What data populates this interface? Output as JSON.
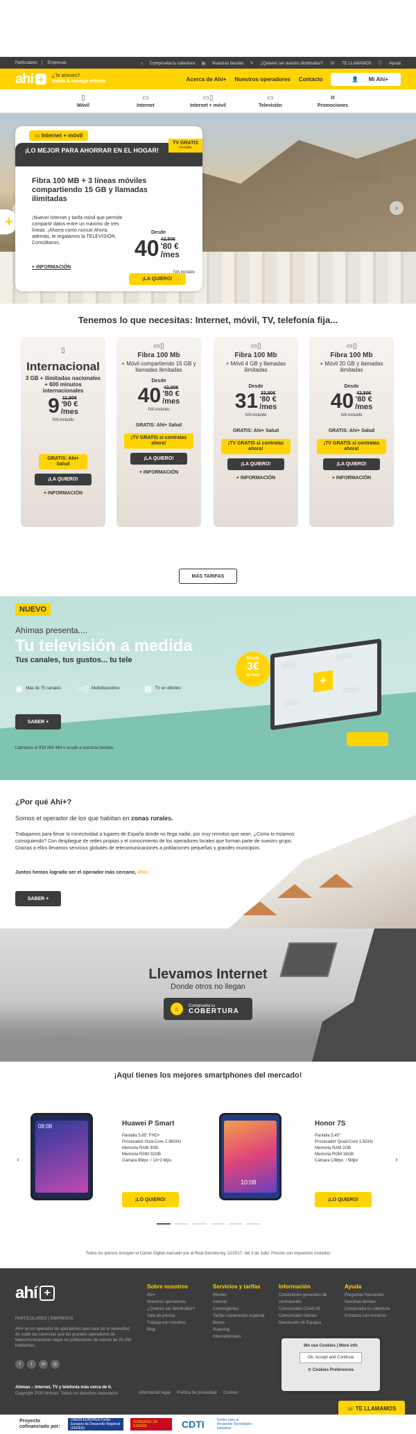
{
  "topbar": {
    "left": [
      "Particulares",
      "Empresas"
    ],
    "right": [
      "Comprueba tu cobertura",
      "Nuestras tiendas",
      "¿Quieres ser nuestro distribuidor?",
      "TE LLAMAMOS",
      "Ayuda"
    ]
  },
  "header": {
    "logo": "ahí",
    "tagline_q": "¿Te atreves?",
    "tagline": "Habla & navega infinito",
    "nav": [
      "Acerca de Ahí+",
      "Nuestros operadores",
      "Contacto"
    ],
    "my_account": "Mi Ahí+"
  },
  "subnav": [
    {
      "label": "Móvil",
      "icon": "mobile-icon"
    },
    {
      "label": "Internet",
      "icon": "desktop-icon"
    },
    {
      "label": "Internet + móvil",
      "icon": "devices-icon"
    },
    {
      "label": "Televisión",
      "icon": "tv-icon"
    },
    {
      "label": "Promociones",
      "icon": "tag-icon"
    }
  ],
  "hero": {
    "tag": "Internet + móvil",
    "tv_badge": "TV GRATIS",
    "tv_badge_sub": "Incluida",
    "dark_title": "¡LO MEJOR PARA AHORRAR EN EL HOGAR!",
    "title": "Fibra 100 MB + 3 líneas móviles compartiendo 15 GB y llamadas ilimitadas",
    "desc": "¡Nuevo! Internet y tarifa móvil que permite compartir datos entre un máximo de tres líneas. ¡Ahorra como nunca! Ahora, además, te regalamos la TELEVISIÓN. Consúltanos.",
    "more": "+ INFORMACIÓN",
    "from": "Desde",
    "old_price": "42,80€",
    "price_int": "40",
    "price_dec": "'80 €",
    "per": "/mes",
    "iva": "IVA incluido",
    "cta": "¡LA QUIERO!"
  },
  "section_title": "Tenemos lo que necesitas: Internet, móvil, TV, telefonía fija...",
  "cards": [
    {
      "title": "Internacional",
      "sub": "3 GB + ilimitadas nacionales + 600 minutos internacionales",
      "from": "",
      "old": "11,90€",
      "int": "9",
      "dec": "'90 €",
      "per": "/mes",
      "iva": "IVA incluido",
      "gift": "",
      "promo": "GRATIS: Ahí+ Salud",
      "cta": "¡LA QUIERO!",
      "info": "+ INFORMACIÓN"
    },
    {
      "title": "Fibra 100 Mb",
      "sub": "+ Móvil compartiendo 15 GB y llamadas ilimitadas",
      "from": "Desde",
      "old": "42,80€",
      "int": "40",
      "dec": "'80 €",
      "per": "/mes",
      "iva": "IVA incluido",
      "gift": "GRATIS: Ahí+ Salud",
      "promo": "¡TV GRATIS si contratas ahora!",
      "cta": "¡LA QUIERO!",
      "info": "+ INFORMACIÓN"
    },
    {
      "title": "Fibra 100 Mb",
      "sub": "+ Móvil 4 GB y llamadas ilimitadas",
      "from": "Desde",
      "old": "33,80€",
      "int": "31",
      "dec": "'80 €",
      "per": "/mes",
      "iva": "IVA incluido",
      "gift": "GRATIS: Ahí+ Salud",
      "promo": "¡TV GRATIS si contratas ahora!",
      "cta": "¡LA QUIERO!",
      "info": "+ INFORMACIÓN"
    },
    {
      "title": "Fibra 100 Mb",
      "sub": "+ Móvil 20 GB y llamadas ilimitadas",
      "from": "Desde",
      "old": "42,80€",
      "int": "40",
      "dec": "'80 €",
      "per": "/mes",
      "iva": "IVA incluido",
      "gift": "GRATIS: Ahí+ Salud",
      "promo": "¡TV GRATIS si contratas ahora!",
      "cta": "¡LA QUIERO!",
      "info": "+ INFORMACIÓN"
    }
  ],
  "more_rates": "MÁS TARIFAS",
  "tv": {
    "badge": "NUEVO",
    "pre": "Ahímas presenta....",
    "title": "Tu televisión a medida",
    "sub": "Tus canales, tus gustos... tu tele",
    "features": [
      "Más de 75 canales",
      "Multidispositivo",
      "TV en diferido"
    ],
    "cta": "SABER +",
    "call": "Llámanos al 916 266 464 o acude a nuestras tiendas.",
    "price_from": "Desde",
    "price": "3€",
    "price_per": "al mes",
    "screen_words": [
      "Cine",
      "Deporte",
      "Infantil",
      "Música"
    ]
  },
  "why": {
    "q": "¿Por qué Ahí+?",
    "l1_pre": "Somos el operador de los que habitan en ",
    "l1_bold": "zonas rurales.",
    "p": "Trabajamos para llevar la conectividad a lugares de España donde no llega nadie, por muy remotos que sean. ¿Cómo lo estamos consiguiendo? Con despliegue de redes propias y el conocimiento de los operadores locales que forman parte de nuestro grupo. Gracias a ellos llevamos servicios globales de telecomunicaciones a poblaciones pequeñas y grandes municipios.",
    "p2_pre": "Juntos hemos logrado ser el operador más cercano, ",
    "p2_brand": "Ahí+.",
    "cta": "SABER +"
  },
  "internet": {
    "title": "Llevamos Internet",
    "sub": "Donde otros no llegan",
    "btn_small": "Comprueba tu",
    "btn_big": "COBERTURA"
  },
  "phones": {
    "title": "¡Aquí tienes los mejores smartphones del mercado!",
    "items": [
      {
        "name": "Huawei P Smart",
        "specs": [
          "Pantalla 5,65\" FHD+",
          "Procesador Octa-Core 2,36GHz",
          "Memoria RAM 3GB",
          "Memoria ROM 32GB",
          "Cámara 8Mpx. / 13+2 Mpx."
        ],
        "cta": "¡LO QUIERO!",
        "time": "08:08"
      },
      {
        "name": "Honor 7S",
        "specs": [
          "Pantalla 5,45\"",
          "Procesador Quad-Core 1,5GHz",
          "Memoria RAM 2GB",
          "Memoria ROM 16GB",
          "Cámara 13Mpx. / 5Mpx"
        ],
        "cta": "¡LO QUIERO!",
        "time": "10:08"
      }
    ]
  },
  "disclaimer": "Todos los precios incluyen el Canon Digital marcado por el Real Decreto-ley 12/2017, del 3 de Julio. Precios con impuestos incluidos",
  "footer": {
    "logo": "ahí",
    "segments": "PARTICULARES  |  EMPRESAS",
    "about": "Ahí+ es un operador de operadores que nace de la necesidad de suplir las carencias que los grandes operadores de telecomunicaciones dejan en poblaciones de menos de 25.000 habitantes.",
    "cols": [
      {
        "h": "Sobre nosotros",
        "items": [
          "Ahí+",
          "Nuestros operadores",
          "¿Quieres ser distribuidor?",
          "Sala de prensa",
          "Trabaja con nosotros",
          "Blog"
        ]
      },
      {
        "h": "Servicios y tarifas",
        "items": [
          "Móviles",
          "Internet",
          "Convergentes",
          "Tarifas numeración especial",
          "Bonos",
          "Roaming",
          "Internacionales"
        ]
      },
      {
        "h": "Información",
        "items": [
          "Condiciones generales de contratación",
          "Comunicado Covid-19",
          "Comunicado clientes",
          "Devolución de Equipos"
        ]
      },
      {
        "h": "Ayuda",
        "items": [
          "Preguntas frecuentes",
          "Nuestras tiendas",
          "Comprueba tu cobertura",
          "Contacta con nosotros"
        ]
      }
    ],
    "bottom_bold": "Ahímas – Internet, TV y telefonía más cerca de ti.",
    "copyright": "Copyright 2020 Ahímas. Todos los derechos reservados",
    "legal": [
      "Información legal",
      "Política de privacidad",
      "Cookies"
    ]
  },
  "cookie": {
    "title": "We use Cookies | More info",
    "accept": "Ok, Accept and Continue",
    "prefs": "Cookies Preferences"
  },
  "call_btn": "TE LLAMAMOS",
  "cofin": {
    "title": "Proyecto cofinanciado por:",
    "logos": [
      "UNIÓN EUROPEA Fondo Europeo de Desarrollo Regional (FEDER)",
      "GOBIERNO DE ESPAÑA",
      "CDTI",
      "Centro para el Desarrollo Tecnológico Industrial"
    ]
  }
}
